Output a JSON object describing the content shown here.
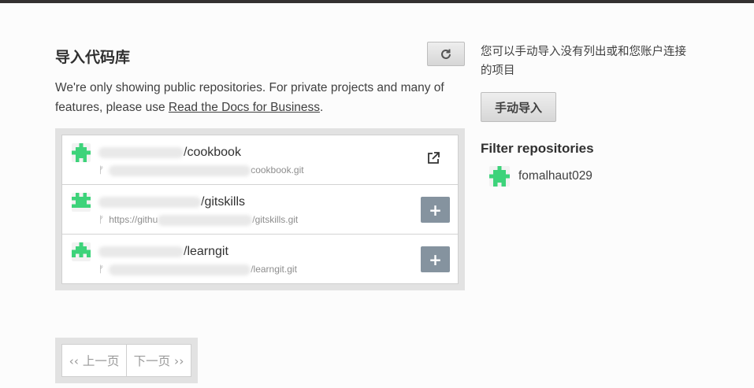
{
  "title": "导入代码库",
  "notice": {
    "text_before": "We're only showing public repositories. For private projects and many of features, please use ",
    "link_text": "Read the Docs for Business",
    "text_after": "."
  },
  "repos": [
    {
      "name": "/cookbook",
      "url": "cookbook.git",
      "action": "external-link"
    },
    {
      "name": "/gitskills",
      "url_prefix": "https://githu",
      "url": "/gitskills.git",
      "action": "add",
      "action_label": "+"
    },
    {
      "name": "/learngit",
      "url": "/learngit.git",
      "action": "add",
      "action_label": "+"
    }
  ],
  "pager": {
    "prev": "‹‹ 上一页",
    "next": "下一页 ››"
  },
  "sidebar": {
    "note": "您可以手动导入没有列出或和您账户连接的项目",
    "manual_button": "手动导入",
    "filter_title": "Filter repositories",
    "filter_user": "fomalhaut029"
  },
  "colors": {
    "avatar_green": "#3dd37a",
    "button_slate": "#85939f",
    "panel_gray": "#e2e2e2"
  }
}
